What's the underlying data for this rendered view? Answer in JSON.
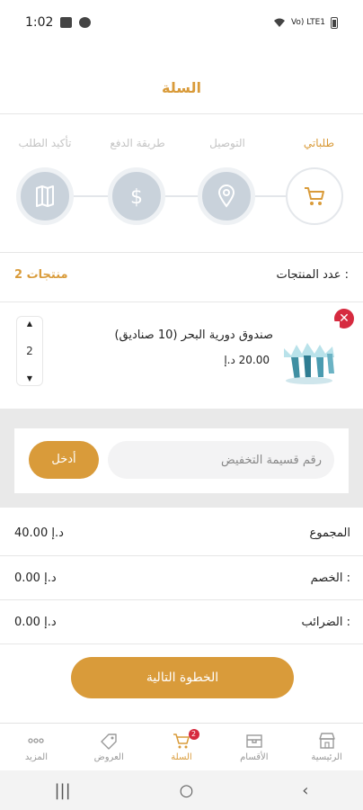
{
  "status_bar": {
    "time": "1:02",
    "network": "Vo) LTE1"
  },
  "header": {
    "title": "السلة"
  },
  "steps": [
    {
      "label": "طلباتي",
      "icon": "cart-icon",
      "active": true
    },
    {
      "label": "التوصيل",
      "icon": "location-pin-icon",
      "active": false
    },
    {
      "label": "طريقة الدفع",
      "icon": "dollar-icon",
      "active": false
    },
    {
      "label": "تأكيد الطلب",
      "icon": "map-icon",
      "active": false
    }
  ],
  "product_count": {
    "label": "عدد المنتجات :",
    "value": "2 منتجات"
  },
  "product": {
    "name": "صندوق دورية البحر (10 صناديق)",
    "price": "20.00 د.إ",
    "quantity": "2",
    "remove_symbol": "✕"
  },
  "coupon": {
    "placeholder": "رقم قسيمة التخفيض",
    "button_label": "أدخل"
  },
  "summary": {
    "total_label": "المجموع",
    "total_value": "40.00 د.إ",
    "discount_label": "الخصم :",
    "discount_value": "0.00 د.إ",
    "tax_label": "الضرائب :",
    "tax_value": "0.00 د.إ"
  },
  "next_button": "الخطوة التالية",
  "tabs": [
    {
      "label": "المزيد",
      "icon": "more-dots-icon"
    },
    {
      "label": "العروض",
      "icon": "tag-icon"
    },
    {
      "label": "السلة",
      "icon": "cart-icon",
      "badge": "2",
      "active": true
    },
    {
      "label": "الأقسام",
      "icon": "box-icon"
    },
    {
      "label": "الرئيسية",
      "icon": "store-icon"
    }
  ],
  "colors": {
    "accent": "#d99b3a",
    "remove": "#d62a3f",
    "step_inactive": "#c9d2db"
  }
}
